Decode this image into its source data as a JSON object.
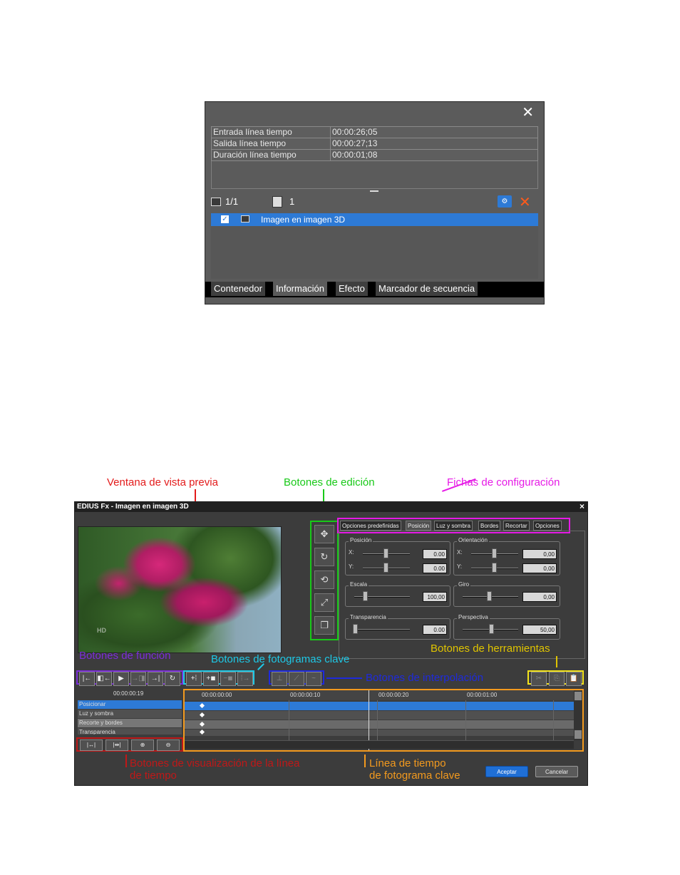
{
  "info_palette": {
    "rows": [
      {
        "label": "Entrada línea tiempo",
        "value": "00:00:26;05"
      },
      {
        "label": "Salida línea tiempo",
        "value": "00:00:27;13"
      },
      {
        "label": "Duración línea tiempo",
        "value": "00:00:01;08"
      }
    ],
    "page_count": "1/1",
    "clip_count": "1",
    "effect_name": "Imagen en imagen 3D",
    "tabs": [
      "Contenedor",
      "Información",
      "Efecto",
      "Marcador de secuencia"
    ]
  },
  "annotations": {
    "preview": "Ventana de vista previa",
    "edit_buttons": "Botones de edición",
    "settings_tabs": "Fichas de configuración",
    "function_buttons": "Botones de función",
    "keyframe_buttons": "Botones de fotogramas clave",
    "tool_buttons": "Botones de herramientas",
    "interp_buttons": "Botones de interpolación",
    "timeline_view_1": "Botones de visualización de la línea",
    "timeline_view_2": "de tiempo",
    "kf_timeline_1": "Línea de tiempo",
    "kf_timeline_2": "de fotograma clave"
  },
  "fx_dialog": {
    "title": "EDIUS Fx - Imagen en imagen 3D",
    "close": "×",
    "tabs": [
      "Opciones predefinidas",
      "Posición",
      "Luz y sombra",
      "Bordes",
      "Recortar",
      "Opciones"
    ],
    "groups": {
      "posicion": {
        "label": "Posición",
        "x_label": "X:",
        "x": "0.00",
        "y_label": "Y:",
        "y": "0.00"
      },
      "orientacion": {
        "label": "Orientación",
        "x_label": "X:",
        "x": "0,00",
        "y_label": "Y:",
        "y": "0,00"
      },
      "escala": {
        "label": "Escala",
        "value": "100,00"
      },
      "giro": {
        "label": "Giro",
        "value": "0,00"
      },
      "transparencia": {
        "label": "Transparencia",
        "value": "0.00"
      },
      "perspectiva": {
        "label": "Perspectiva",
        "value": "50,00"
      }
    },
    "current_time": "00:00:00:19",
    "timecodes": [
      "00:00:00:00",
      "00:00:00:10",
      "00:00:00:20",
      "00:00:01:00"
    ],
    "tracks": [
      "Posicionar",
      "Luz y sombra",
      "Recorte y bordes",
      "Transparencia"
    ],
    "ok_label": "Aceptar",
    "cancel_label": "Cancelar"
  }
}
